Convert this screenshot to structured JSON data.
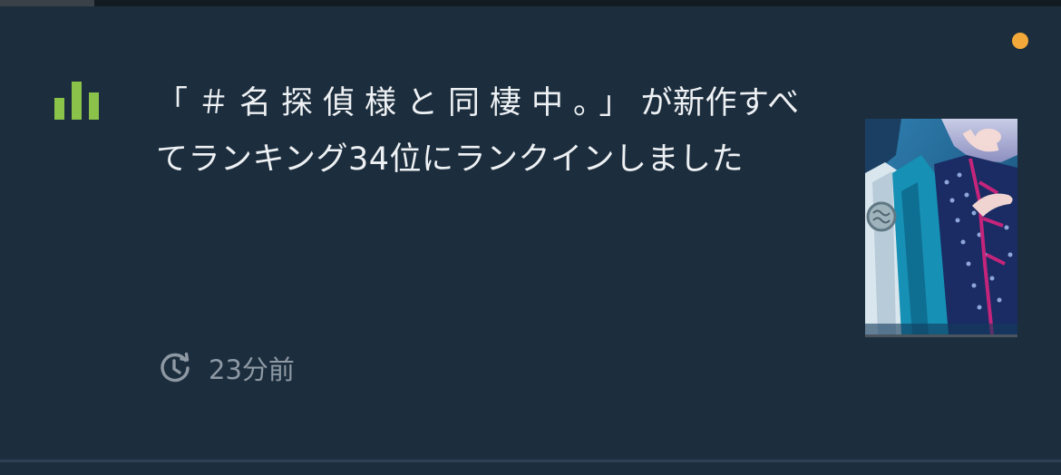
{
  "notification": {
    "title_bracketed": "「＃名探偵様と同棲中。」",
    "title_suffix": "が新作",
    "body": "すべてランキング34位にランクインしました",
    "time": "23分前",
    "unread": true
  },
  "icons": {
    "leading": "bar-chart-icon",
    "time": "clock-history-icon"
  },
  "colors": {
    "background": "#1c2d3d",
    "accent_green": "#8bc34a",
    "unread_dot": "#f2a93a",
    "text_primary": "#eef1f4",
    "text_secondary": "#8e99a4"
  }
}
